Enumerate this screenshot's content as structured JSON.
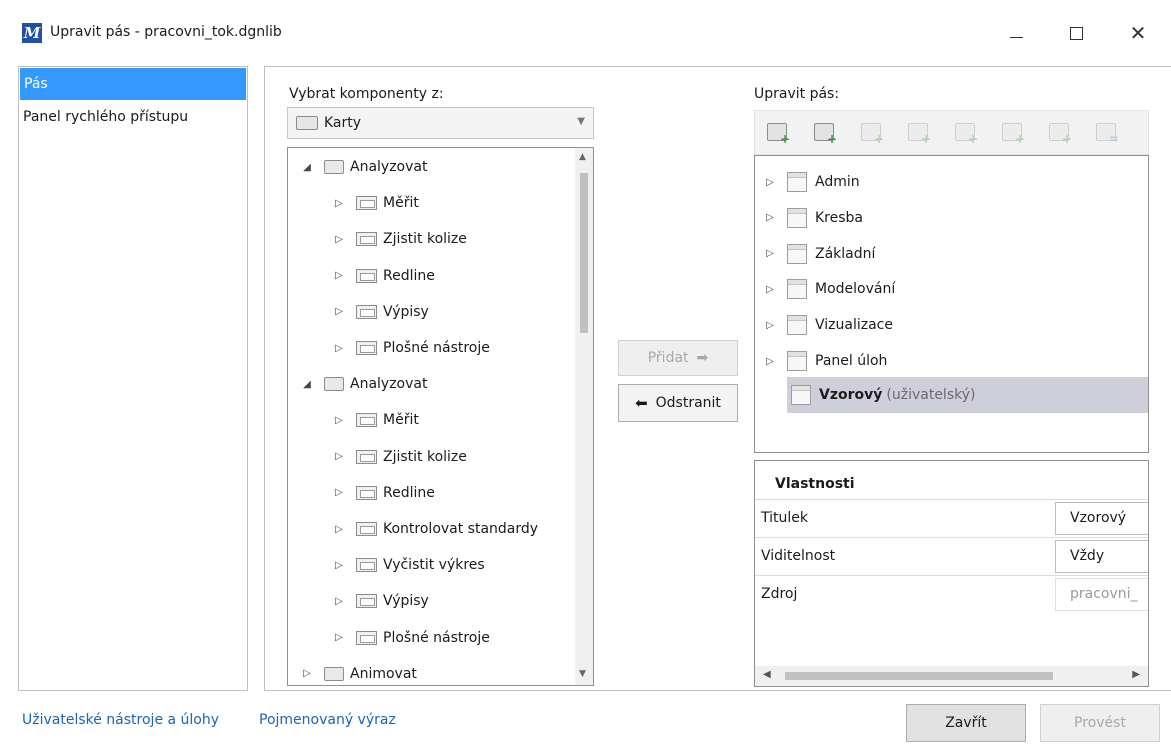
{
  "window": {
    "icon_letter": "M",
    "title": "Upravit pás - pracovni_tok.dgnlib"
  },
  "nav": {
    "items": [
      {
        "label": "Pás",
        "selected": true
      },
      {
        "label": "Panel rychlého přístupu",
        "selected": false
      }
    ]
  },
  "left": {
    "label": "Vybrat komponenty z:",
    "combo_value": "Karty",
    "tree": [
      {
        "label": "Analyzovat",
        "level": 0,
        "kind": "tab",
        "expanded": true
      },
      {
        "label": "Měřit",
        "level": 1,
        "kind": "group"
      },
      {
        "label": "Zjistit kolize",
        "level": 1,
        "kind": "group"
      },
      {
        "label": "Redline",
        "level": 1,
        "kind": "group"
      },
      {
        "label": "Výpisy",
        "level": 1,
        "kind": "group"
      },
      {
        "label": "Plošné nástroje",
        "level": 1,
        "kind": "group"
      },
      {
        "label": "Analyzovat",
        "level": 0,
        "kind": "tab",
        "expanded": true
      },
      {
        "label": "Měřit",
        "level": 1,
        "kind": "group"
      },
      {
        "label": "Zjistit kolize",
        "level": 1,
        "kind": "group"
      },
      {
        "label": "Redline",
        "level": 1,
        "kind": "group"
      },
      {
        "label": "Kontrolovat standardy",
        "level": 1,
        "kind": "group"
      },
      {
        "label": "Vyčistit výkres",
        "level": 1,
        "kind": "group"
      },
      {
        "label": "Výpisy",
        "level": 1,
        "kind": "group"
      },
      {
        "label": "Plošné nástroje",
        "level": 1,
        "kind": "group"
      },
      {
        "label": "Animovat",
        "level": 0,
        "kind": "tab",
        "expanded": false
      }
    ]
  },
  "middle": {
    "add_label": "Přidat",
    "remove_label": "Odstranit"
  },
  "right": {
    "label": "Upravit pás:",
    "toolbar_icons": [
      "new-tab-icon",
      "new-group-icon",
      "new-panel-icon",
      "new-split-icon",
      "new-button-icon",
      "new-row-icon",
      "new-item-icon",
      "new-separator-icon"
    ],
    "tree": [
      {
        "label": "Admin"
      },
      {
        "label": "Kresba"
      },
      {
        "label": "Základní"
      },
      {
        "label": "Modelování"
      },
      {
        "label": "Vizualizace"
      },
      {
        "label": "Panel úloh"
      }
    ],
    "selected_item": {
      "label": "Vzorový",
      "suffix": "(uživatelský)"
    }
  },
  "properties": {
    "title": "Vlastnosti",
    "rows": [
      {
        "key": "Titulek",
        "value": "Vzorový"
      },
      {
        "key": "Viditelnost",
        "value": "Vždy"
      },
      {
        "key": "Zdroj",
        "value": "pracovni_"
      }
    ]
  },
  "footer": {
    "link1": "Uživatelské nástroje a úlohy",
    "link2": "Pojmenovaný výraz",
    "close_label": "Zavřít",
    "run_label": "Provést"
  },
  "colors": {
    "selection": "#3399ff",
    "link": "#1a64b4",
    "tree_selection": "#cfcfdb"
  }
}
